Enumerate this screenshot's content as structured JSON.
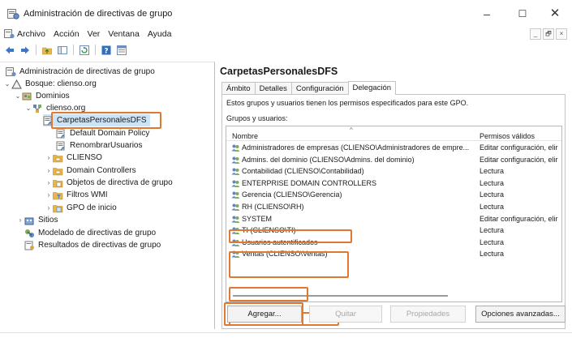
{
  "window": {
    "title": "Administración de directivas de grupo",
    "controls": {
      "minimize": "–",
      "maximize": "☐",
      "close": "✕"
    }
  },
  "menubar": {
    "items": [
      "Archivo",
      "Acción",
      "Ver",
      "Ventana",
      "Ayuda"
    ],
    "mdi_controls": [
      "_",
      "🗗",
      "×"
    ]
  },
  "toolbar": {
    "icons": [
      "back-arrow-icon",
      "forward-arrow-icon",
      "folder-up-icon",
      "console-tree-icon",
      "refresh-icon",
      "help-icon",
      "properties-icon"
    ]
  },
  "tree": {
    "items": [
      {
        "label": "Administración de directivas de grupo",
        "icon": "gpmc-icon",
        "chevron": ""
      },
      {
        "label": "Bosque: clienso.org",
        "icon": "forest-icon",
        "chevron": "⌄"
      },
      {
        "label": "Dominios",
        "icon": "domains-icon",
        "chevron": "⌄"
      },
      {
        "label": "clienso.org",
        "icon": "domain-icon",
        "chevron": "⌄"
      },
      {
        "label": "CarpetasPersonalesDFS",
        "icon": "gpo-link-icon",
        "chevron": "",
        "selected": true
      },
      {
        "label": "Default Domain Policy",
        "icon": "gpo-link-icon",
        "chevron": ""
      },
      {
        "label": "RenombrarUsuarios",
        "icon": "gpo-link-icon",
        "chevron": ""
      },
      {
        "label": "CLIENSO",
        "icon": "ou-icon",
        "chevron": "›"
      },
      {
        "label": "Domain Controllers",
        "icon": "ou-icon",
        "chevron": "›"
      },
      {
        "label": "Objetos de directiva de grupo",
        "icon": "gpo-folder-icon",
        "chevron": "›"
      },
      {
        "label": "Filtros WMI",
        "icon": "wmi-folder-icon",
        "chevron": "›"
      },
      {
        "label": "GPO de inicio",
        "icon": "starter-gpo-icon",
        "chevron": "›"
      },
      {
        "label": "Sitios",
        "icon": "sites-icon",
        "chevron": "›"
      },
      {
        "label": "Modelado de directivas de grupo",
        "icon": "modeling-icon",
        "chevron": ""
      },
      {
        "label": "Resultados de directivas de grupo",
        "icon": "results-icon",
        "chevron": ""
      }
    ]
  },
  "content": {
    "title": "CarpetasPersonalesDFS",
    "tabs": [
      {
        "label": "Ámbito",
        "active": false
      },
      {
        "label": "Detalles",
        "active": false
      },
      {
        "label": "Configuración",
        "active": false
      },
      {
        "label": "Delegación",
        "active": true
      }
    ],
    "description": "Estos grupos y usuarios tienen los permisos especificados para este GPO.",
    "groups_label": "Grupos y usuarios:",
    "columns": {
      "name": "Nombre",
      "perms": "Permisos válidos",
      "sort_indicator": "^"
    },
    "rows": [
      {
        "name": "Administradores de empresas (CLIENSO\\Administradores de empre...",
        "perms": "Editar configuración, elir"
      },
      {
        "name": "Admins. del dominio (CLIENSO\\Admins. del dominio)",
        "perms": "Editar configuración, elir"
      },
      {
        "name": "Contabilidad (CLIENSO\\Contabilidad)",
        "perms": "Lectura"
      },
      {
        "name": "ENTERPRISE DOMAIN CONTROLLERS",
        "perms": "Lectura"
      },
      {
        "name": "Gerencia (CLIENSO\\Gerencia)",
        "perms": "Lectura"
      },
      {
        "name": "RH (CLIENSO\\RH)",
        "perms": "Lectura"
      },
      {
        "name": "SYSTEM",
        "perms": "Editar configuración, elir"
      },
      {
        "name": "TI (CLIENSO\\TI)",
        "perms": "Lectura"
      },
      {
        "name": "Usuarios autentificados",
        "perms": "Lectura"
      },
      {
        "name": "Ventas (CLIENSO\\Ventas)",
        "perms": "Lectura"
      }
    ],
    "buttons": {
      "add": "Agregar...",
      "remove": "Quitar",
      "properties": "Propiedades",
      "advanced": "Opciones avanzadas..."
    }
  },
  "colors": {
    "highlight": "#e07830",
    "folder": "#e8b64a",
    "selection": "#cce4f7"
  }
}
